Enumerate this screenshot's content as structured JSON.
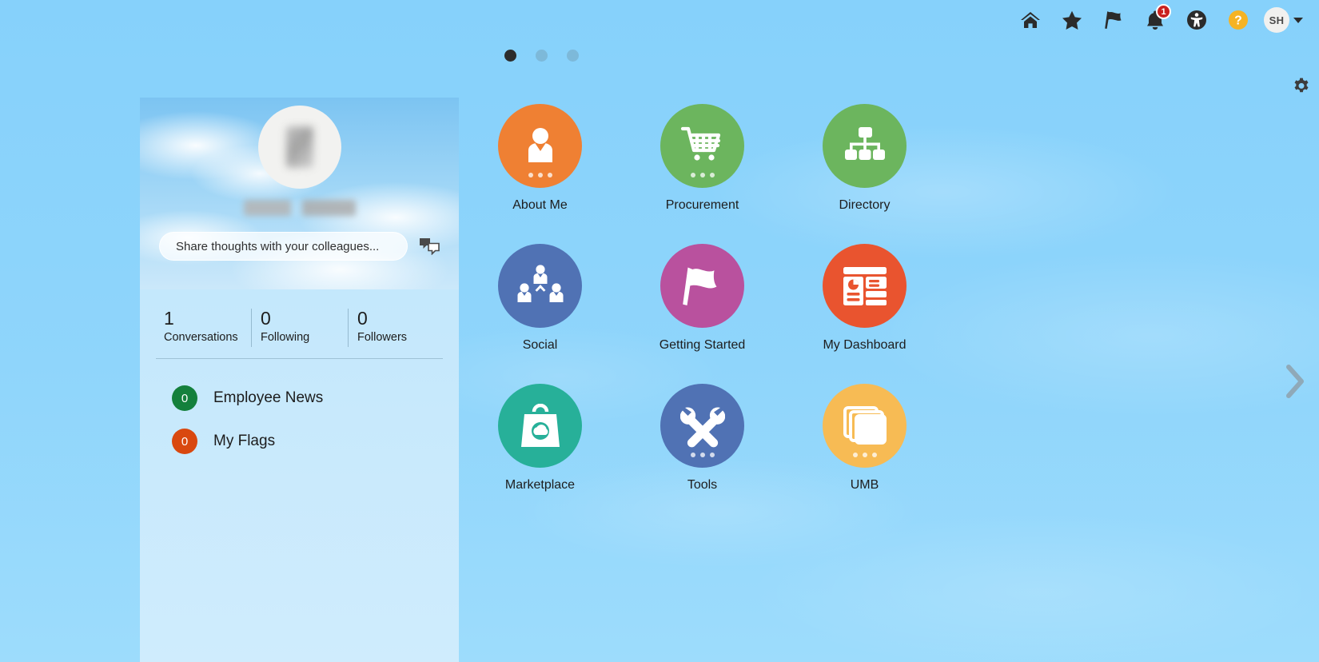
{
  "theme": {
    "page_bg": "#87d2fb",
    "panel_bg": "#c5e8fc",
    "badge_red": "#c9211e",
    "help_yellow": "#f5b324"
  },
  "header": {
    "icons": [
      {
        "name": "home-icon",
        "title": "Home"
      },
      {
        "name": "favorites-star-icon",
        "title": "Favorites"
      },
      {
        "name": "flag-icon",
        "title": "Flags"
      },
      {
        "name": "notifications-bell-icon",
        "title": "Notifications",
        "badge": "1"
      },
      {
        "name": "accessibility-icon",
        "title": "Accessibility"
      },
      {
        "name": "help-icon",
        "title": "Help"
      }
    ],
    "avatar_initials": "SH"
  },
  "pager": {
    "dots": [
      {
        "label": "1",
        "active": true
      },
      {
        "label": "2",
        "active": false
      },
      {
        "label": "3",
        "active": false
      }
    ]
  },
  "page_settings": {
    "label": "Settings",
    "icon": "gear-icon"
  },
  "next_page": {
    "label": "Next",
    "icon": "chevron-right-icon"
  },
  "profile": {
    "share_placeholder": "Share thoughts with your colleagues...",
    "share_value": "",
    "chat_icon": "conversation-bubbles-icon",
    "stats": [
      {
        "value": "1",
        "label": "Conversations"
      },
      {
        "value": "0",
        "label": "Following"
      },
      {
        "value": "0",
        "label": "Followers"
      }
    ],
    "lists": [
      {
        "count": "0",
        "label": "Employee News",
        "color": "#14803c",
        "icon": "news-badge-icon"
      },
      {
        "count": "0",
        "label": "My Flags",
        "color": "#d9480f",
        "icon": "flags-badge-icon"
      }
    ]
  },
  "apps": [
    {
      "label": "About Me",
      "icon": "person-card-icon",
      "color": "#ef8033",
      "ellipsis": true
    },
    {
      "label": "Procurement",
      "icon": "shopping-cart-icon",
      "color": "#6cb55e",
      "ellipsis": true
    },
    {
      "label": "Directory",
      "icon": "org-chart-icon",
      "color": "#6cb55e",
      "ellipsis": false
    },
    {
      "label": "Social",
      "icon": "people-group-icon",
      "color": "#5072b4",
      "ellipsis": false
    },
    {
      "label": "Getting Started",
      "icon": "flag-wave-icon",
      "color": "#b9519e",
      "ellipsis": false
    },
    {
      "label": "My Dashboard",
      "icon": "dashboard-icon",
      "color": "#e9542f",
      "ellipsis": false
    },
    {
      "label": "Marketplace",
      "icon": "shopping-bag-icon",
      "color": "#27b099",
      "ellipsis": false
    },
    {
      "label": "Tools",
      "icon": "tools-icon",
      "color": "#5072b4",
      "ellipsis": true
    },
    {
      "label": "UMB",
      "icon": "stacked-cards-icon",
      "color": "#f7bb54",
      "ellipsis": true
    }
  ]
}
